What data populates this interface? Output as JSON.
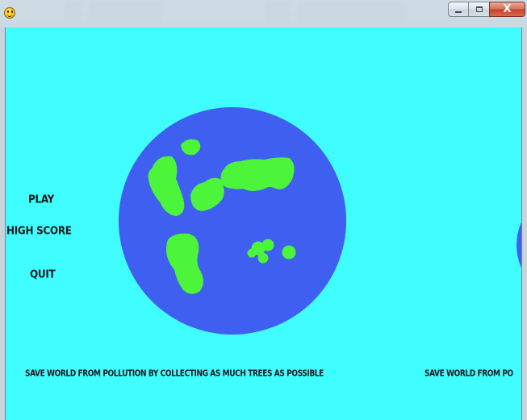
{
  "window": {
    "title_icon": "smiley-icon",
    "controls": {
      "minimize_icon": "minimize-icon",
      "maximize_icon": "maximize-icon",
      "close_label": "X"
    }
  },
  "menu": {
    "play": "PLAY",
    "high_score": "HIGH SCORE",
    "quit": "QUIT"
  },
  "tagline": "SAVE WORLD FROM POLLUTION BY COLLECTING AS MUCH TREES AS POSSIBLE",
  "tagline_repeat": "SAVE WORLD FROM PO",
  "colors": {
    "sky": "#40feff",
    "ocean": "#3f5ff0",
    "land": "#4cf43a",
    "text": "#1a1a1a"
  }
}
